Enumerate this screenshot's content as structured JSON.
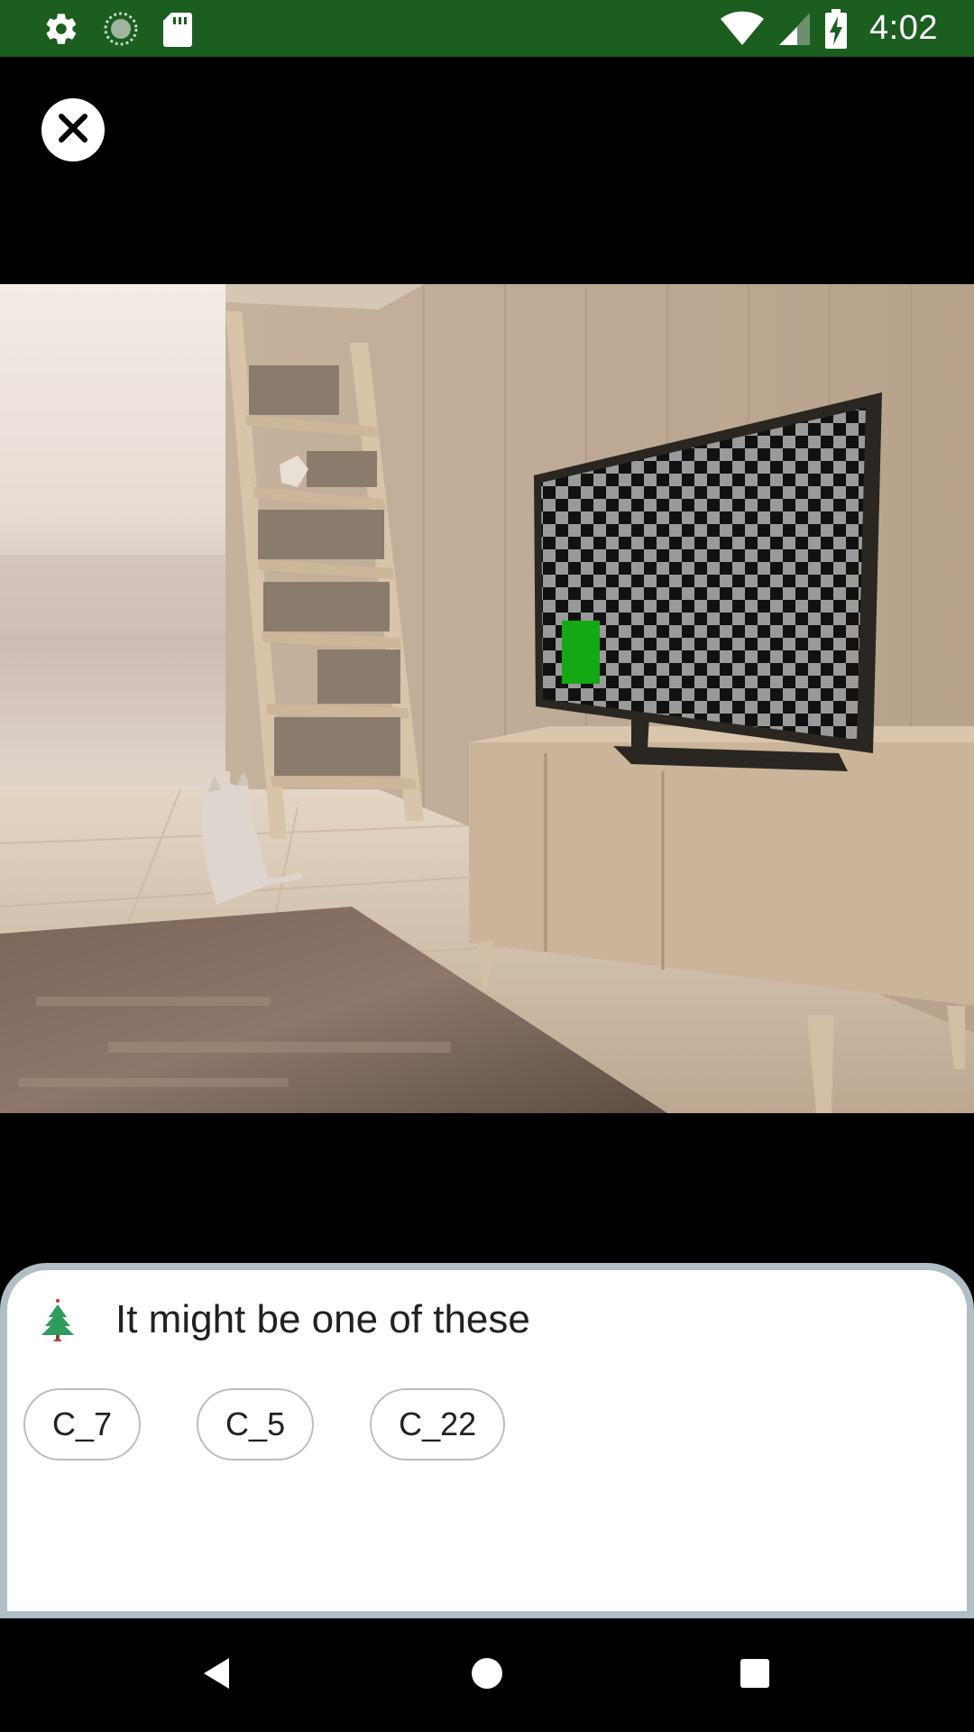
{
  "status_bar": {
    "time": "4:02",
    "left_icons": [
      "settings-icon",
      "sync-icon",
      "sd-card-icon"
    ],
    "right_icons": [
      "wifi-icon",
      "signal-icon",
      "battery-charging-icon"
    ],
    "background_color": "#1b5e20"
  },
  "close_button": {
    "icon": "close-icon"
  },
  "camera_preview": {
    "description_icon": "camera-frame",
    "highlight_color": "#14a814"
  },
  "results_sheet": {
    "title": "It might be one of these",
    "chips": [
      {
        "label": "C_7"
      },
      {
        "label": "C_5"
      },
      {
        "label": "C_22"
      }
    ]
  },
  "nav_bar": {
    "buttons": [
      "back-icon",
      "home-icon",
      "recents-icon"
    ]
  }
}
